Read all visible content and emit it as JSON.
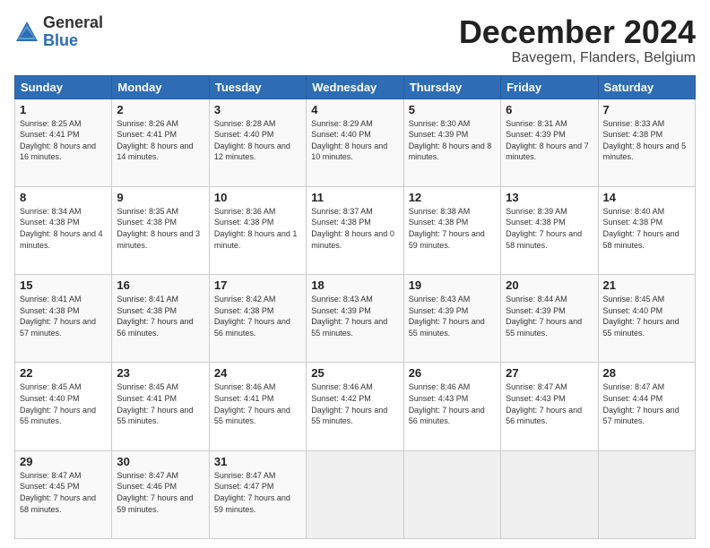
{
  "header": {
    "logo_general": "General",
    "logo_blue": "Blue",
    "month_title": "December 2024",
    "location": "Bavegem, Flanders, Belgium"
  },
  "weekdays": [
    "Sunday",
    "Monday",
    "Tuesday",
    "Wednesday",
    "Thursday",
    "Friday",
    "Saturday"
  ],
  "weeks": [
    [
      {
        "day": "1",
        "sunrise": "8:25 AM",
        "sunset": "4:41 PM",
        "daylight": "8 hours and 16 minutes."
      },
      {
        "day": "2",
        "sunrise": "8:26 AM",
        "sunset": "4:41 PM",
        "daylight": "8 hours and 14 minutes."
      },
      {
        "day": "3",
        "sunrise": "8:28 AM",
        "sunset": "4:40 PM",
        "daylight": "8 hours and 12 minutes."
      },
      {
        "day": "4",
        "sunrise": "8:29 AM",
        "sunset": "4:40 PM",
        "daylight": "8 hours and 10 minutes."
      },
      {
        "day": "5",
        "sunrise": "8:30 AM",
        "sunset": "4:39 PM",
        "daylight": "8 hours and 8 minutes."
      },
      {
        "day": "6",
        "sunrise": "8:31 AM",
        "sunset": "4:39 PM",
        "daylight": "8 hours and 7 minutes."
      },
      {
        "day": "7",
        "sunrise": "8:33 AM",
        "sunset": "4:38 PM",
        "daylight": "8 hours and 5 minutes."
      }
    ],
    [
      {
        "day": "8",
        "sunrise": "8:34 AM",
        "sunset": "4:38 PM",
        "daylight": "8 hours and 4 minutes."
      },
      {
        "day": "9",
        "sunrise": "8:35 AM",
        "sunset": "4:38 PM",
        "daylight": "8 hours and 3 minutes."
      },
      {
        "day": "10",
        "sunrise": "8:36 AM",
        "sunset": "4:38 PM",
        "daylight": "8 hours and 1 minute."
      },
      {
        "day": "11",
        "sunrise": "8:37 AM",
        "sunset": "4:38 PM",
        "daylight": "8 hours and 0 minutes."
      },
      {
        "day": "12",
        "sunrise": "8:38 AM",
        "sunset": "4:38 PM",
        "daylight": "7 hours and 59 minutes."
      },
      {
        "day": "13",
        "sunrise": "8:39 AM",
        "sunset": "4:38 PM",
        "daylight": "7 hours and 58 minutes."
      },
      {
        "day": "14",
        "sunrise": "8:40 AM",
        "sunset": "4:38 PM",
        "daylight": "7 hours and 58 minutes."
      }
    ],
    [
      {
        "day": "15",
        "sunrise": "8:41 AM",
        "sunset": "4:38 PM",
        "daylight": "7 hours and 57 minutes."
      },
      {
        "day": "16",
        "sunrise": "8:41 AM",
        "sunset": "4:38 PM",
        "daylight": "7 hours and 56 minutes."
      },
      {
        "day": "17",
        "sunrise": "8:42 AM",
        "sunset": "4:38 PM",
        "daylight": "7 hours and 56 minutes."
      },
      {
        "day": "18",
        "sunrise": "8:43 AM",
        "sunset": "4:39 PM",
        "daylight": "7 hours and 55 minutes."
      },
      {
        "day": "19",
        "sunrise": "8:43 AM",
        "sunset": "4:39 PM",
        "daylight": "7 hours and 55 minutes."
      },
      {
        "day": "20",
        "sunrise": "8:44 AM",
        "sunset": "4:39 PM",
        "daylight": "7 hours and 55 minutes."
      },
      {
        "day": "21",
        "sunrise": "8:45 AM",
        "sunset": "4:40 PM",
        "daylight": "7 hours and 55 minutes."
      }
    ],
    [
      {
        "day": "22",
        "sunrise": "8:45 AM",
        "sunset": "4:40 PM",
        "daylight": "7 hours and 55 minutes."
      },
      {
        "day": "23",
        "sunrise": "8:45 AM",
        "sunset": "4:41 PM",
        "daylight": "7 hours and 55 minutes."
      },
      {
        "day": "24",
        "sunrise": "8:46 AM",
        "sunset": "4:41 PM",
        "daylight": "7 hours and 55 minutes."
      },
      {
        "day": "25",
        "sunrise": "8:46 AM",
        "sunset": "4:42 PM",
        "daylight": "7 hours and 55 minutes."
      },
      {
        "day": "26",
        "sunrise": "8:46 AM",
        "sunset": "4:43 PM",
        "daylight": "7 hours and 56 minutes."
      },
      {
        "day": "27",
        "sunrise": "8:47 AM",
        "sunset": "4:43 PM",
        "daylight": "7 hours and 56 minutes."
      },
      {
        "day": "28",
        "sunrise": "8:47 AM",
        "sunset": "4:44 PM",
        "daylight": "7 hours and 57 minutes."
      }
    ],
    [
      {
        "day": "29",
        "sunrise": "8:47 AM",
        "sunset": "4:45 PM",
        "daylight": "7 hours and 58 minutes."
      },
      {
        "day": "30",
        "sunrise": "8:47 AM",
        "sunset": "4:46 PM",
        "daylight": "7 hours and 59 minutes."
      },
      {
        "day": "31",
        "sunrise": "8:47 AM",
        "sunset": "4:47 PM",
        "daylight": "7 hours and 59 minutes."
      },
      null,
      null,
      null,
      null
    ]
  ]
}
